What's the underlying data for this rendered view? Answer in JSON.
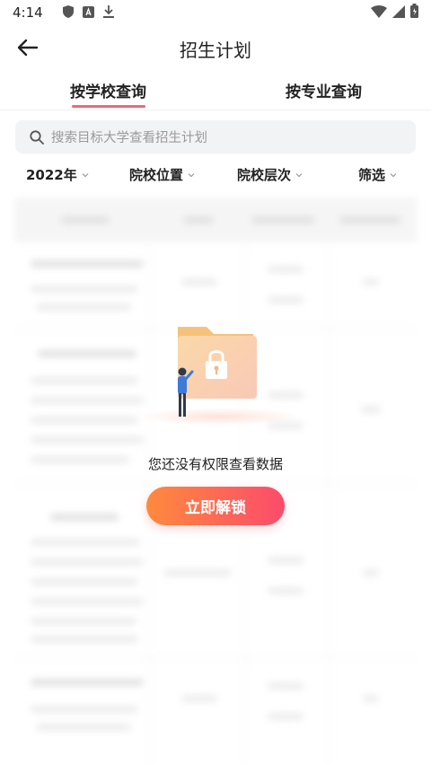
{
  "status_bar": {
    "time": "4:14"
  },
  "header": {
    "title": "招生计划"
  },
  "tabs": [
    {
      "label": "按学校查询",
      "active": true
    },
    {
      "label": "按专业查询",
      "active": false
    }
  ],
  "search": {
    "placeholder": "搜索目标大学查看招生计划"
  },
  "filters": [
    {
      "label": "2022年"
    },
    {
      "label": "院校位置"
    },
    {
      "label": "院校层次"
    },
    {
      "label": "筛选"
    }
  ],
  "locked": {
    "message": "您还没有权限查看数据",
    "button_label": "立即解锁"
  },
  "colors": {
    "accent": "#f0677a",
    "button_start": "#ff8a3d",
    "button_end": "#fb4b6b",
    "folder": "#f6c27a"
  }
}
